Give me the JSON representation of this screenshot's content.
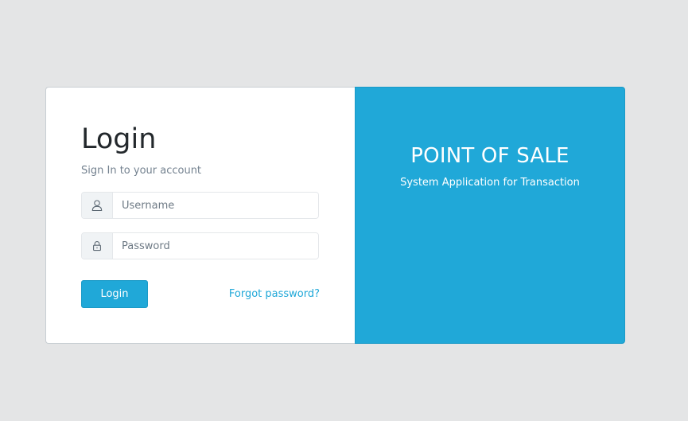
{
  "login": {
    "title": "Login",
    "subtitle": "Sign In to your account",
    "username_placeholder": "Username",
    "password_placeholder": "Password",
    "submit_label": "Login",
    "forgot_label": "Forgot password?",
    "username_icon": "user-icon",
    "password_icon": "lock-icon"
  },
  "brand": {
    "title": "POINT OF SALE",
    "subtitle": "System Application for Transaction"
  },
  "colors": {
    "background": "#e4e5e6",
    "primary": "#20a8d8",
    "card": "#ffffff"
  }
}
